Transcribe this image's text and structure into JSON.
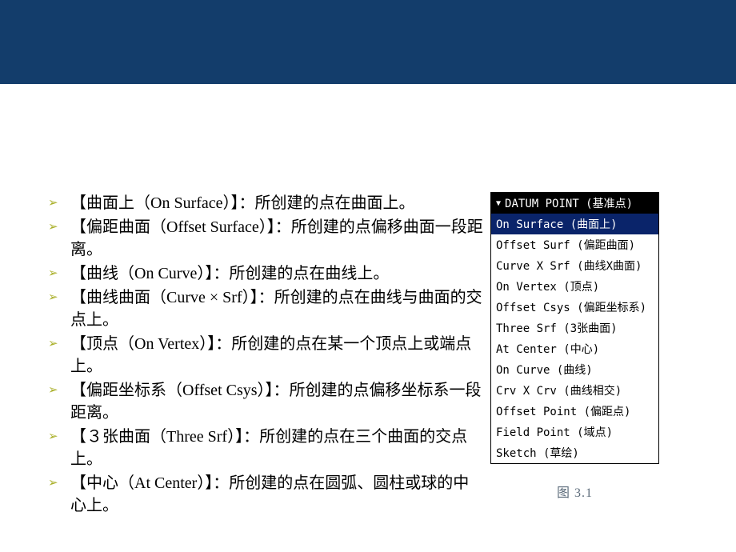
{
  "bullets": [
    {
      "term_zh": "曲面上",
      "term_en": "On Surface",
      "desc": "：所创建的点在曲面上。"
    },
    {
      "term_zh": "偏距曲面",
      "term_en": "Offset Surface",
      "desc": "：所创建的点偏移曲面一段距离。"
    },
    {
      "term_zh": "曲线",
      "term_en": "On Curve",
      "desc": "：所创建的点在曲线上。"
    },
    {
      "term_zh": "曲线曲面",
      "term_en": "Curve × Srf",
      "desc": "：所创建的点在曲线与曲面的交点上。"
    },
    {
      "term_zh": "顶点",
      "term_en": "On Vertex",
      "desc": "：所创建的点在某一个顶点上或端点上。"
    },
    {
      "term_zh": "偏距坐标系",
      "term_en": "Offset Csys",
      "desc": "：所创建的点偏移坐标系一段距离。"
    },
    {
      "term_zh": "３张曲面",
      "term_en": "Three Srf",
      "desc": "：所创建的点在三个曲面的交点上。"
    },
    {
      "term_zh": "中心",
      "term_en": "At Center",
      "desc": "：所创建的点在圆弧、圆柱或球的中心上。"
    }
  ],
  "panel": {
    "title": "DATUM POINT (基准点)",
    "items": [
      {
        "label": "On Surface (曲面上)",
        "selected": true
      },
      {
        "label": "Offset Surf (偏距曲面)",
        "selected": false
      },
      {
        "label": "Curve X Srf (曲线X曲面)",
        "selected": false
      },
      {
        "label": "On Vertex (顶点)",
        "selected": false
      },
      {
        "label": "Offset Csys (偏距坐标系)",
        "selected": false
      },
      {
        "label": "Three Srf (3张曲面)",
        "selected": false
      },
      {
        "label": "At Center (中心)",
        "selected": false
      },
      {
        "label": "On Curve (曲线)",
        "selected": false
      },
      {
        "label": "Crv X Crv (曲线相交)",
        "selected": false
      },
      {
        "label": "Offset Point (偏距点)",
        "selected": false
      },
      {
        "label": "Field Point (域点)",
        "selected": false
      },
      {
        "label": "Sketch (草绘)",
        "selected": false
      }
    ]
  },
  "caption": "图 3.1",
  "bracket_open": "【",
  "bracket_close": "】",
  "paren_open": "（",
  "paren_close": "）",
  "marker": "➢"
}
